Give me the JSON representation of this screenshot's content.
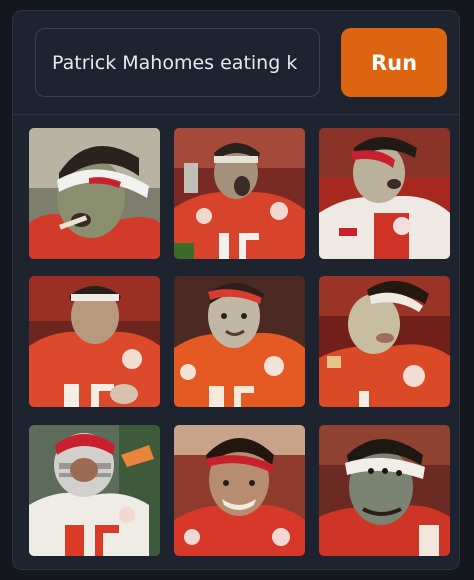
{
  "prompt": {
    "value": "Patrick Mahomes eating k"
  },
  "run_button": {
    "label": "Run"
  },
  "colors": {
    "accent": "#dd6410",
    "panel": "#1d2430",
    "background": "#14171e",
    "jersey_red": "#d23a2a",
    "headband": "#c8202c"
  },
  "images": {
    "count": 9,
    "columns": 3,
    "rows": 3
  }
}
